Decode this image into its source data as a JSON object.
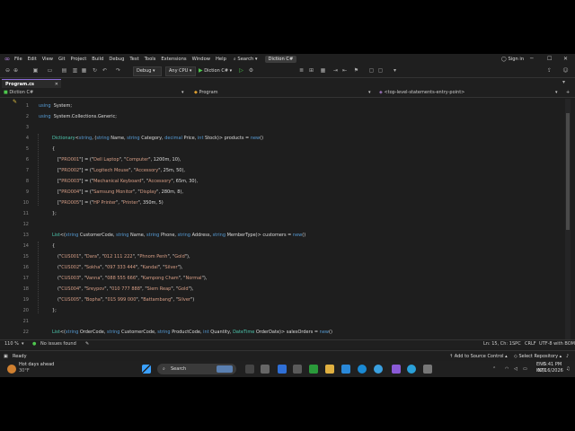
{
  "menu": {
    "items": [
      "File",
      "Edit",
      "View",
      "Git",
      "Project",
      "Build",
      "Debug",
      "Test",
      "Tools",
      "Extensions",
      "Window",
      "Help"
    ],
    "search": "Search",
    "solution_name": "Diction C#",
    "sign_in": "Sign in"
  },
  "toolbar": {
    "config": "Debug",
    "platform": "Any CPU",
    "run_target": "Diction C#"
  },
  "tab": {
    "filename": "Program.cs"
  },
  "nav": {
    "project": "Diction C#",
    "class": "Program",
    "member": "<top-level-statements-entry-point>"
  },
  "status": {
    "zoom": "110 %",
    "issues": "No issues found",
    "position": "Ln: 15, Ch: 1",
    "spaces": "SPC",
    "eol": "CRLF",
    "encoding": "UTF-8 with BOM"
  },
  "statusbar": {
    "ready": "Ready",
    "source_control": "Add to Source Control",
    "repo": "Select Repository"
  },
  "taskbar": {
    "weather_title": "Hot days ahead",
    "weather_temp": "30°F",
    "search": "Search",
    "lang": "ENG",
    "region": "INTL",
    "time": "5:41 PM",
    "date": "07/16/2026"
  },
  "code_lines": [
    {
      "n": "1",
      "t": [
        [
          "kw",
          "using"
        ],
        [
          "",
          "  System;"
        ]
      ]
    },
    {
      "n": "2",
      "t": [
        [
          "kw",
          "using"
        ],
        [
          "",
          "  System.Collections.Generic;"
        ]
      ]
    },
    {
      "n": "3",
      "t": []
    },
    {
      "n": "4",
      "t": [
        [
          "ty",
          "Dictionary"
        ],
        [
          "",
          "<"
        ],
        [
          "kw",
          "string"
        ],
        [
          "",
          ", ("
        ],
        [
          "kw",
          "string"
        ],
        [
          "",
          " Name, "
        ],
        [
          "kw",
          "string"
        ],
        [
          "",
          " Category, "
        ],
        [
          "kw",
          "decimal"
        ],
        [
          "",
          " Price, "
        ],
        [
          "kw",
          "int"
        ],
        [
          "",
          " Stock)> products = "
        ],
        [
          "kw",
          "new"
        ],
        [
          "",
          "()"
        ]
      ]
    },
    {
      "n": "5",
      "t": [
        [
          "",
          "{"
        ]
      ]
    },
    {
      "n": "6",
      "t": [
        [
          "",
          "[\""
        ],
        [
          "st",
          "PRO001"
        ],
        [
          "",
          "\"] = (\""
        ],
        [
          "st",
          "Dell Laptop"
        ],
        [
          "",
          "\", \""
        ],
        [
          "st",
          "Computer"
        ],
        [
          "",
          "\", 1200m, 10),"
        ]
      ]
    },
    {
      "n": "7",
      "t": [
        [
          "",
          "[\""
        ],
        [
          "st",
          "PRO002"
        ],
        [
          "",
          "\"] = (\""
        ],
        [
          "st",
          "Logitech Mouse"
        ],
        [
          "",
          "\", \""
        ],
        [
          "st",
          "Accessory"
        ],
        [
          "",
          "\", 25m, 50),"
        ]
      ]
    },
    {
      "n": "8",
      "t": [
        [
          "",
          "[\""
        ],
        [
          "st",
          "PRO003"
        ],
        [
          "",
          "\"] = (\""
        ],
        [
          "st",
          "Mechanical Keyboard"
        ],
        [
          "",
          "\", \""
        ],
        [
          "st",
          "Accessory"
        ],
        [
          "",
          "\", 65m, 30),"
        ]
      ]
    },
    {
      "n": "9",
      "t": [
        [
          "",
          "[\""
        ],
        [
          "st",
          "PRO004"
        ],
        [
          "",
          "\"] = (\""
        ],
        [
          "st",
          "Samsung Monitor"
        ],
        [
          "",
          "\", \""
        ],
        [
          "st",
          "Display"
        ],
        [
          "",
          "\", 280m, 8),"
        ]
      ]
    },
    {
      "n": "10",
      "t": [
        [
          "",
          "[\""
        ],
        [
          "st",
          "PRO005"
        ],
        [
          "",
          "\"] = (\""
        ],
        [
          "st",
          "HP Printer"
        ],
        [
          "",
          "\", \""
        ],
        [
          "st",
          "Printer"
        ],
        [
          "",
          "\", 350m, 5)"
        ]
      ]
    },
    {
      "n": "11",
      "t": [
        [
          "",
          "};"
        ]
      ]
    },
    {
      "n": "12",
      "t": []
    },
    {
      "n": "13",
      "t": [
        [
          "ty",
          "List"
        ],
        [
          "",
          "<("
        ],
        [
          "kw",
          "string"
        ],
        [
          "",
          " CustomerCode, "
        ],
        [
          "kw",
          "string"
        ],
        [
          "",
          " Name, "
        ],
        [
          "kw",
          "string"
        ],
        [
          "",
          " Phone, "
        ],
        [
          "kw",
          "string"
        ],
        [
          "",
          " Address, "
        ],
        [
          "kw",
          "string"
        ],
        [
          "",
          " MemberType)> customers = "
        ],
        [
          "kw",
          "new"
        ],
        [
          "",
          "()"
        ]
      ]
    },
    {
      "n": "14",
      "t": [
        [
          "",
          "{"
        ]
      ]
    },
    {
      "n": "15",
      "t": [
        [
          "",
          "(\""
        ],
        [
          "st",
          "CUS001"
        ],
        [
          "",
          "\", \""
        ],
        [
          "st",
          "Dara"
        ],
        [
          "",
          "\", \""
        ],
        [
          "st",
          "012 111 222"
        ],
        [
          "",
          "\", \""
        ],
        [
          "st",
          "Phnom Penh"
        ],
        [
          "",
          "\", \""
        ],
        [
          "st",
          "Gold"
        ],
        [
          "",
          "\"),"
        ]
      ]
    },
    {
      "n": "16",
      "t": [
        [
          "",
          "(\""
        ],
        [
          "st",
          "CUS002"
        ],
        [
          "",
          "\", \""
        ],
        [
          "st",
          "Sokha"
        ],
        [
          "",
          "\", \""
        ],
        [
          "st",
          "097 333 444"
        ],
        [
          "",
          "\", \""
        ],
        [
          "st",
          "Kandal"
        ],
        [
          "",
          "\", \""
        ],
        [
          "st",
          "Silver"
        ],
        [
          "",
          "\"),"
        ]
      ]
    },
    {
      "n": "17",
      "t": [
        [
          "",
          "(\""
        ],
        [
          "st",
          "CUS003"
        ],
        [
          "",
          "\", \""
        ],
        [
          "st",
          "Vanna"
        ],
        [
          "",
          "\", \""
        ],
        [
          "st",
          "088 555 666"
        ],
        [
          "",
          "\", \""
        ],
        [
          "st",
          "Kampong Cham"
        ],
        [
          "",
          "\", \""
        ],
        [
          "st",
          "Normal"
        ],
        [
          "",
          "\"),"
        ]
      ]
    },
    {
      "n": "18",
      "t": [
        [
          "",
          "(\""
        ],
        [
          "st",
          "CUS004"
        ],
        [
          "",
          "\", \""
        ],
        [
          "st",
          "Sreypov"
        ],
        [
          "",
          "\", \""
        ],
        [
          "st",
          "010 777 888"
        ],
        [
          "",
          "\", \""
        ],
        [
          "st",
          "Siem Reap"
        ],
        [
          "",
          "\", \""
        ],
        [
          "st",
          "Gold"
        ],
        [
          "",
          "\"),"
        ]
      ]
    },
    {
      "n": "19",
      "t": [
        [
          "",
          "(\""
        ],
        [
          "st",
          "CUS005"
        ],
        [
          "",
          "\", \""
        ],
        [
          "st",
          "Bopha"
        ],
        [
          "",
          "\", \""
        ],
        [
          "st",
          "015 999 000"
        ],
        [
          "",
          "\", \""
        ],
        [
          "st",
          "Battambang"
        ],
        [
          "",
          "\", \""
        ],
        [
          "st",
          "Silver"
        ],
        [
          "",
          "\")"
        ]
      ]
    },
    {
      "n": "20",
      "t": [
        [
          "",
          "};"
        ]
      ]
    },
    {
      "n": "21",
      "t": []
    },
    {
      "n": "22",
      "t": [
        [
          "ty",
          "List"
        ],
        [
          "",
          "<("
        ],
        [
          "kw",
          "string"
        ],
        [
          "",
          " OrderCode, "
        ],
        [
          "kw",
          "string"
        ],
        [
          "",
          " CustomerCode, "
        ],
        [
          "kw",
          "string"
        ],
        [
          "",
          " ProductCode, "
        ],
        [
          "kw",
          "int"
        ],
        [
          "",
          " Quantity, "
        ],
        [
          "ty",
          "DateTime"
        ],
        [
          "",
          " OrderDate)> salesOrders = "
        ],
        [
          "kw",
          "new"
        ],
        [
          "",
          "()"
        ]
      ]
    },
    {
      "n": "23",
      "t": [
        [
          "",
          "{"
        ]
      ]
    }
  ]
}
